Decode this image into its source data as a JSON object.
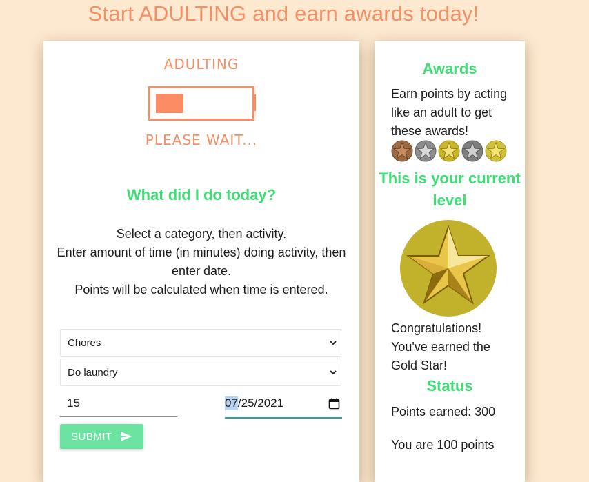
{
  "page": {
    "title": "Start ADULTING and earn awards today!"
  },
  "logo": {
    "word": "ADULTING",
    "wait": "PLEASE WAIT...",
    "progress": 0.3
  },
  "form": {
    "heading": "What did I do today?",
    "instructions": [
      "Select a category, then activity.",
      "Enter amount of time (in minutes) doing activity, then enter date.",
      "Points will be calculated when time is entered."
    ],
    "category_value": "Chores",
    "activity_value": "Do laundry",
    "time_value": "15",
    "date_month": "07",
    "date_rest": "/25/2021",
    "submit_label": "SUBMIT"
  },
  "awards": {
    "heading": "Awards",
    "description": "Earn points by acting like an adult to get these awards!",
    "medals": [
      "bronze-star",
      "silver-star",
      "gold-star",
      "silver-star",
      "gold-star"
    ],
    "level_heading": "This is your current level",
    "current_level": "gold-star",
    "congrats": "Congratulations! You've earned the Gold Star!",
    "status_heading": "Status",
    "points_earned": "Points earned: 300",
    "points_remaining": "You are 100 points"
  },
  "colors": {
    "background": "#fde9d0",
    "accent_orange": "#f59066",
    "heading_green": "#3fdd75",
    "submit_green": "#6de3a2",
    "date_underline": "#26a69a",
    "gold": "#c8b52a"
  }
}
